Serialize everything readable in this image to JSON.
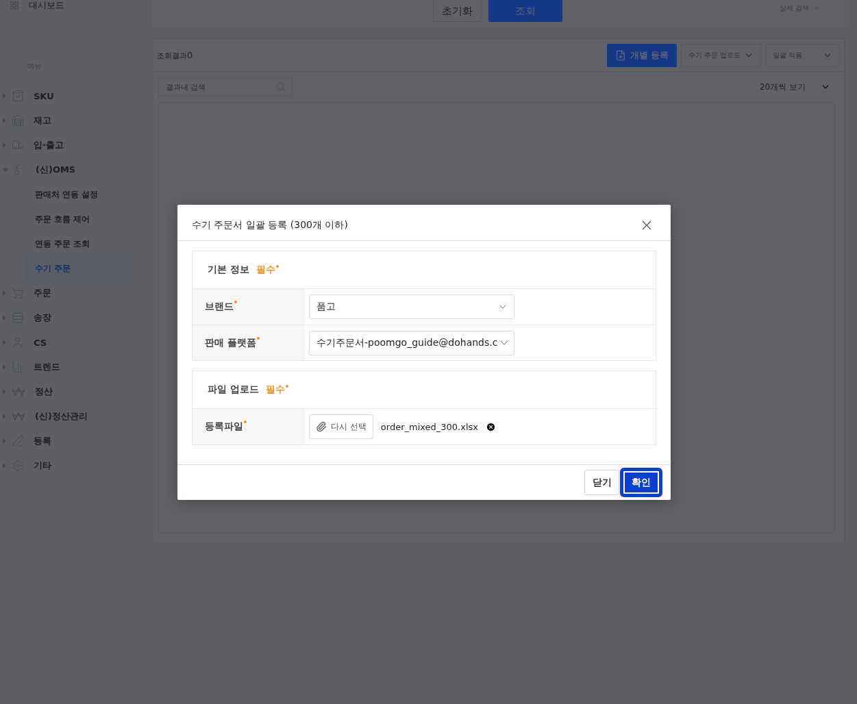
{
  "sidebar": {
    "top_item": {
      "label": "대시보드"
    },
    "section_label": "메뉴",
    "items": [
      {
        "label": "SKU",
        "expanded": false
      },
      {
        "label": "재고",
        "expanded": false
      },
      {
        "label": "입·출고",
        "expanded": false
      },
      {
        "label": "(신)OMS",
        "expanded": true,
        "children": [
          {
            "label": "판매처 연동 설정",
            "selected": false
          },
          {
            "label": "주문 흐름 제어",
            "selected": false
          },
          {
            "label": "연동 주문 조회",
            "selected": false
          },
          {
            "label": "수기 주문",
            "selected": true
          }
        ]
      },
      {
        "label": "주문",
        "expanded": false
      },
      {
        "label": "송장",
        "expanded": false
      },
      {
        "label": "CS",
        "expanded": false
      },
      {
        "label": "트렌드",
        "expanded": false
      },
      {
        "label": "정산",
        "expanded": false
      },
      {
        "label": "(신)정산관리",
        "expanded": false
      },
      {
        "label": "등록",
        "expanded": false
      },
      {
        "label": "기타",
        "expanded": false
      }
    ]
  },
  "search_bar": {
    "buttons": [
      {
        "label": "초기화",
        "kind": "secondary"
      },
      {
        "label": "조회",
        "kind": "primary"
      }
    ],
    "detail_toggle": "상세 검색"
  },
  "results": {
    "count_label": "조회결과",
    "count": "0",
    "register_button": "개별 등록",
    "upload_dropdown": "수기 주문 업로드",
    "bulk_dropdown": "일괄 적용",
    "search": {
      "placeholder": "결과내 검색"
    },
    "page_size": "20개씩 보기"
  },
  "dialog": {
    "title": "수기 주문서 일괄 등록 (300개 이하)",
    "sections": [
      {
        "title": "기본 정보",
        "required_tag": "필수",
        "fields": [
          {
            "label": "브랜드",
            "required": true,
            "kind": "select",
            "value": "품고"
          },
          {
            "label": "판매 플랫폼",
            "required": true,
            "kind": "select",
            "value": "수기주문서-poomgo_guide@dohands.c"
          }
        ]
      },
      {
        "title": "파일 업로드",
        "required_tag": "필수",
        "fields": [
          {
            "label": "등록파일",
            "required": true,
            "kind": "file",
            "button": "다시 선택",
            "file_name": "order_mixed_300.xlsx"
          }
        ]
      }
    ],
    "buttons": [
      {
        "label": "닫기",
        "kind": "secondary",
        "focused": false
      },
      {
        "label": "확인",
        "kind": "primary",
        "focused": true
      }
    ]
  }
}
